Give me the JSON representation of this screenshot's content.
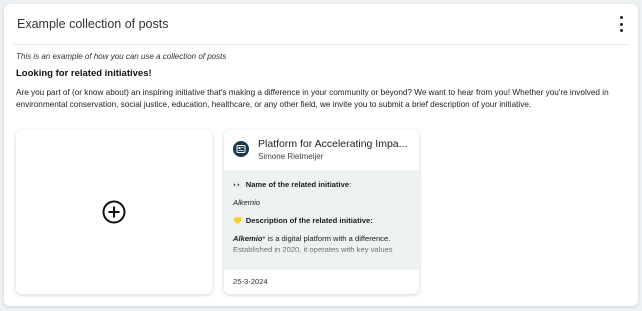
{
  "panel": {
    "title": "Example collection of posts",
    "menu_icon": "more-vertical-icon"
  },
  "content": {
    "intro": "This is an example of how you can use a collection of posts",
    "heading": "Looking for related initiatives!",
    "body": "Are you part of (or know about) an inspiring initiative that's making a difference in your community or beyond? We want to hear from you! Whether you're involved in environmental conservation, social justice, education, healthcare, or any other field, we invite you to submit a brief description of your initiative."
  },
  "add_card": {
    "icon": "add-circle-icon"
  },
  "post": {
    "title": "Platform for Accelerating Impa...",
    "author": "Simone Rietmeijer",
    "icon": "post-document-icon",
    "name_label": "Name of the related initiative",
    "name_colon": ":",
    "name_value": "Alkemio",
    "desc_label": "Description of the related initiative:",
    "desc_bold": "Alkemio",
    "desc_rest": "* is a digital platform with a difference.",
    "desc_more": "Established in 2020, it operates with key values",
    "date": "25-3-2024"
  },
  "colors": {
    "accent": "#1d384a",
    "card_body": "#eef2f3",
    "background": "#eef1f3"
  }
}
